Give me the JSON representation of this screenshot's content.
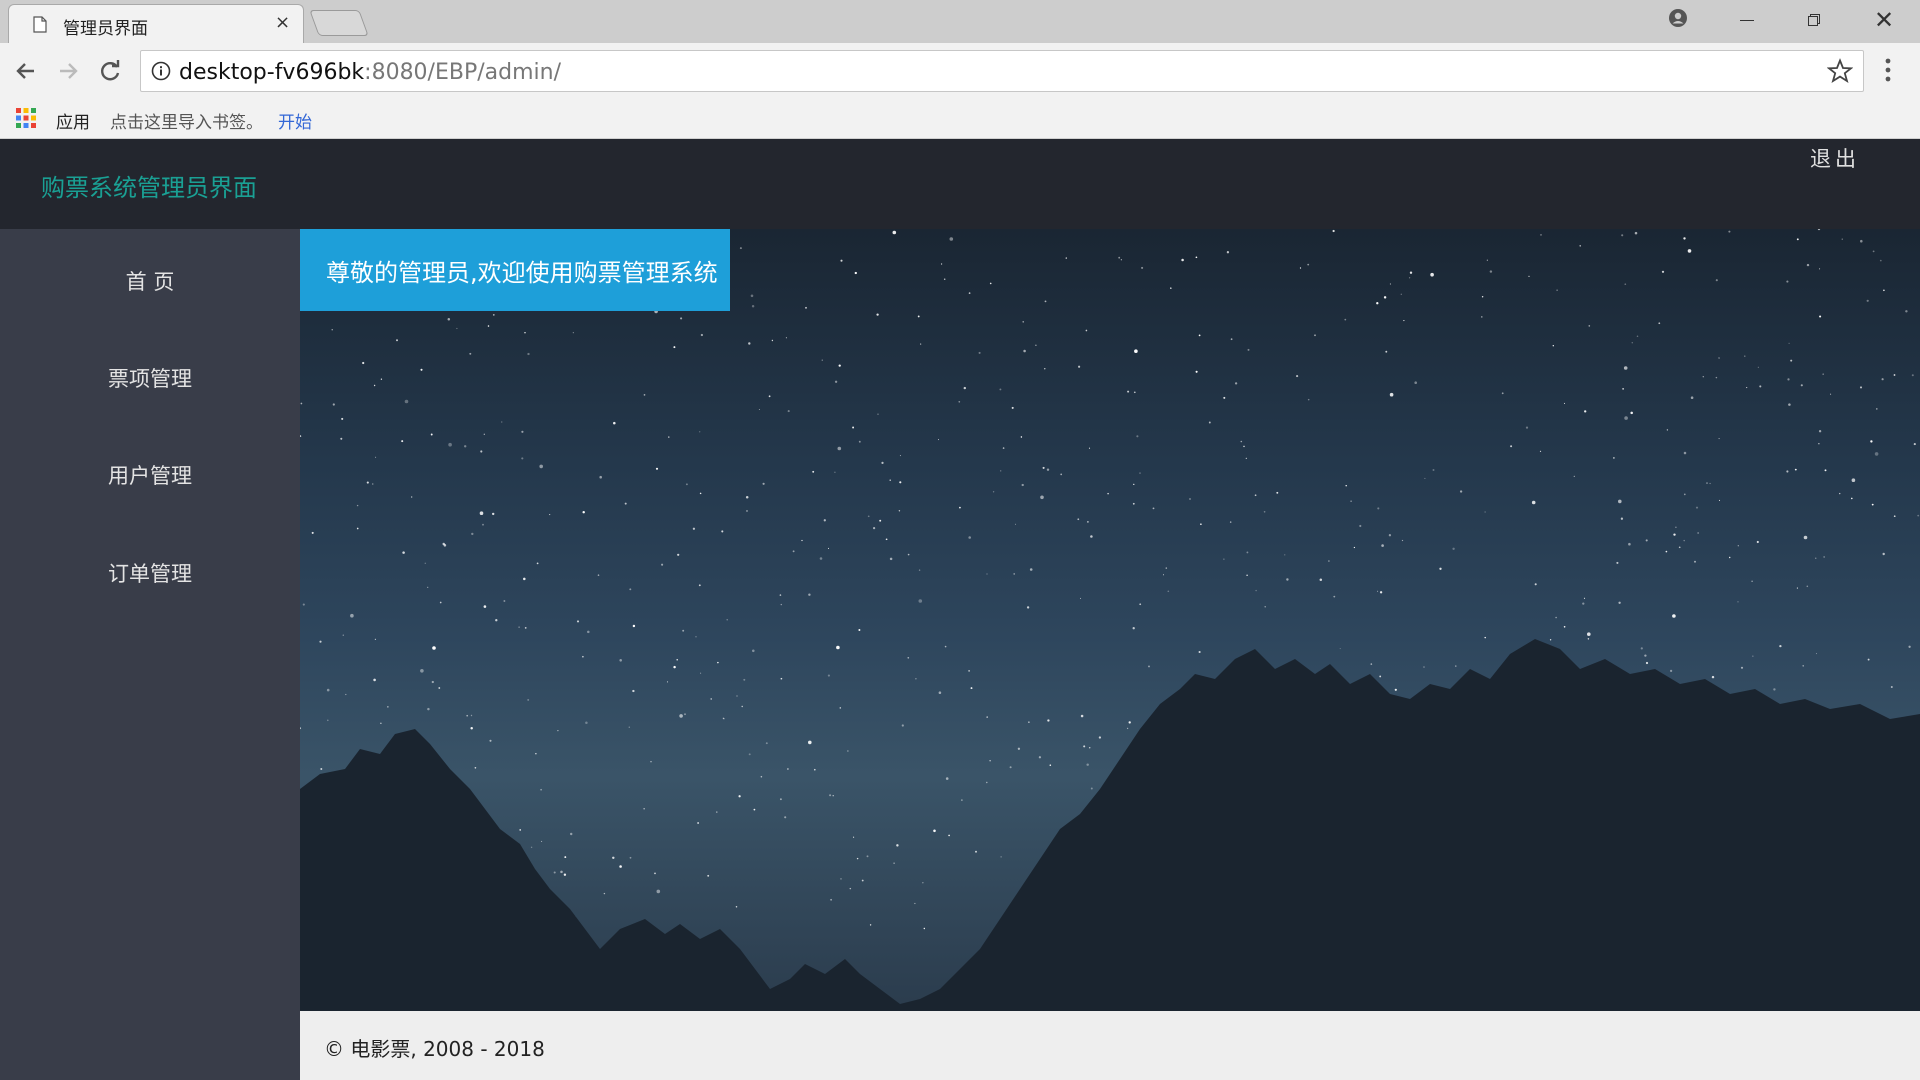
{
  "browser": {
    "tab_title": "管理员界面",
    "tab_close": "×",
    "window_close": "✕",
    "url_host": "desktop-fv696bk",
    "url_rest": ":8080/EBP/admin/",
    "bookmarks": {
      "apps_label": "应用",
      "hint": "点击这里导入书签。",
      "start_link": "开始"
    }
  },
  "header": {
    "brand": "购票系统管理员界面",
    "logout": "退出",
    "brand_color": "#1aa094"
  },
  "sidebar": {
    "items": [
      {
        "label": "首 页"
      },
      {
        "label": "票项管理"
      },
      {
        "label": "用户管理"
      },
      {
        "label": "订单管理"
      }
    ]
  },
  "main": {
    "welcome": "尊敬的管理员,欢迎使用购票管理系统",
    "welcome_color": "#1e9fd9"
  },
  "footer": {
    "copyright": "© 电影票, 2008 - 2018"
  }
}
